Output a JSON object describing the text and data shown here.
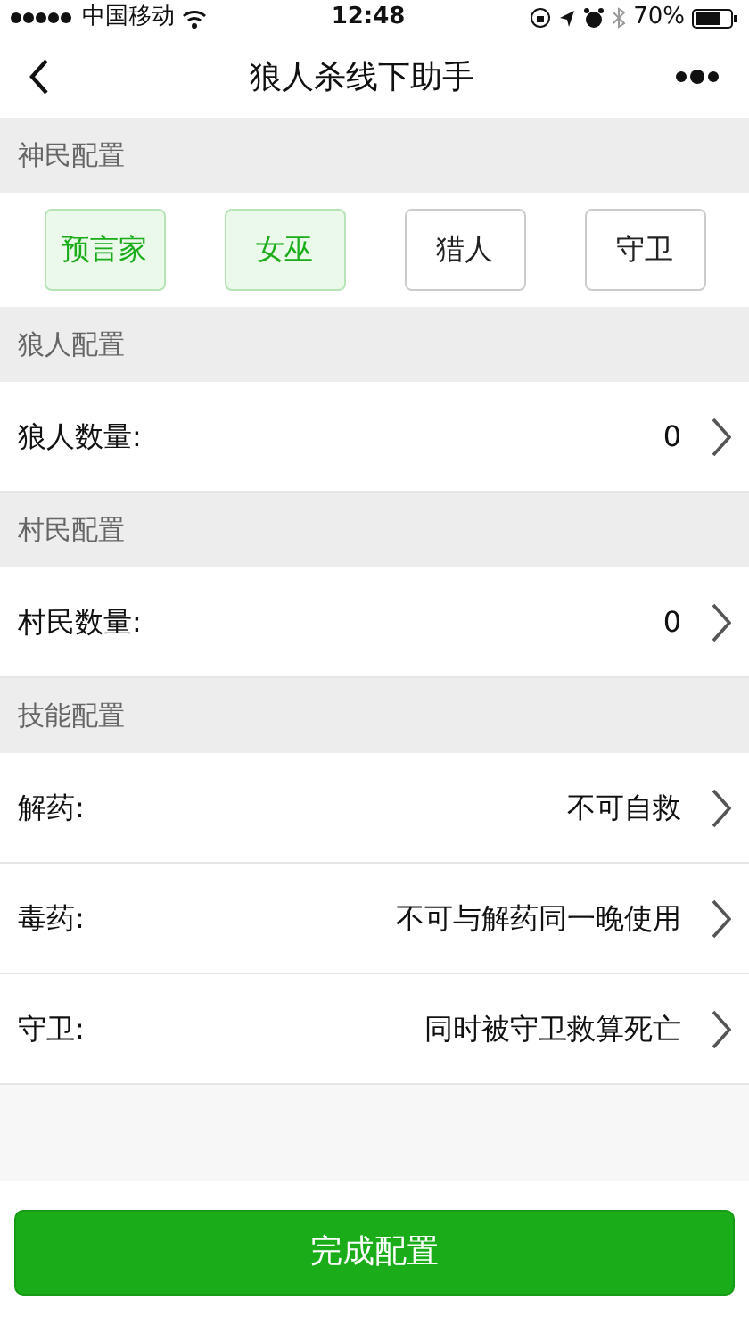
{
  "status_bar": {
    "carrier": "中国移动",
    "time": "12:48",
    "battery": "70%"
  },
  "nav": {
    "title": "狼人杀线下助手"
  },
  "sections": [
    {
      "header": "神民配置",
      "kind": "roles",
      "roles": [
        {
          "label": "预言家",
          "selected": true
        },
        {
          "label": "女巫",
          "selected": true
        },
        {
          "label": "猎人",
          "selected": false
        },
        {
          "label": "守卫",
          "selected": false
        }
      ]
    },
    {
      "header": "狼人配置",
      "kind": "rows",
      "rows": [
        {
          "label": "狼人数量:",
          "value": "0"
        }
      ]
    },
    {
      "header": "村民配置",
      "kind": "rows",
      "rows": [
        {
          "label": "村民数量:",
          "value": "0"
        }
      ]
    },
    {
      "header": "技能配置",
      "kind": "rows",
      "rows": [
        {
          "label": "解药:",
          "value": "不可自救"
        },
        {
          "label": "毒药:",
          "value": "不可与解药同一晚使用"
        },
        {
          "label": "守卫:",
          "value": "同时被守卫救算死亡"
        }
      ]
    }
  ],
  "submit": "完成配置"
}
